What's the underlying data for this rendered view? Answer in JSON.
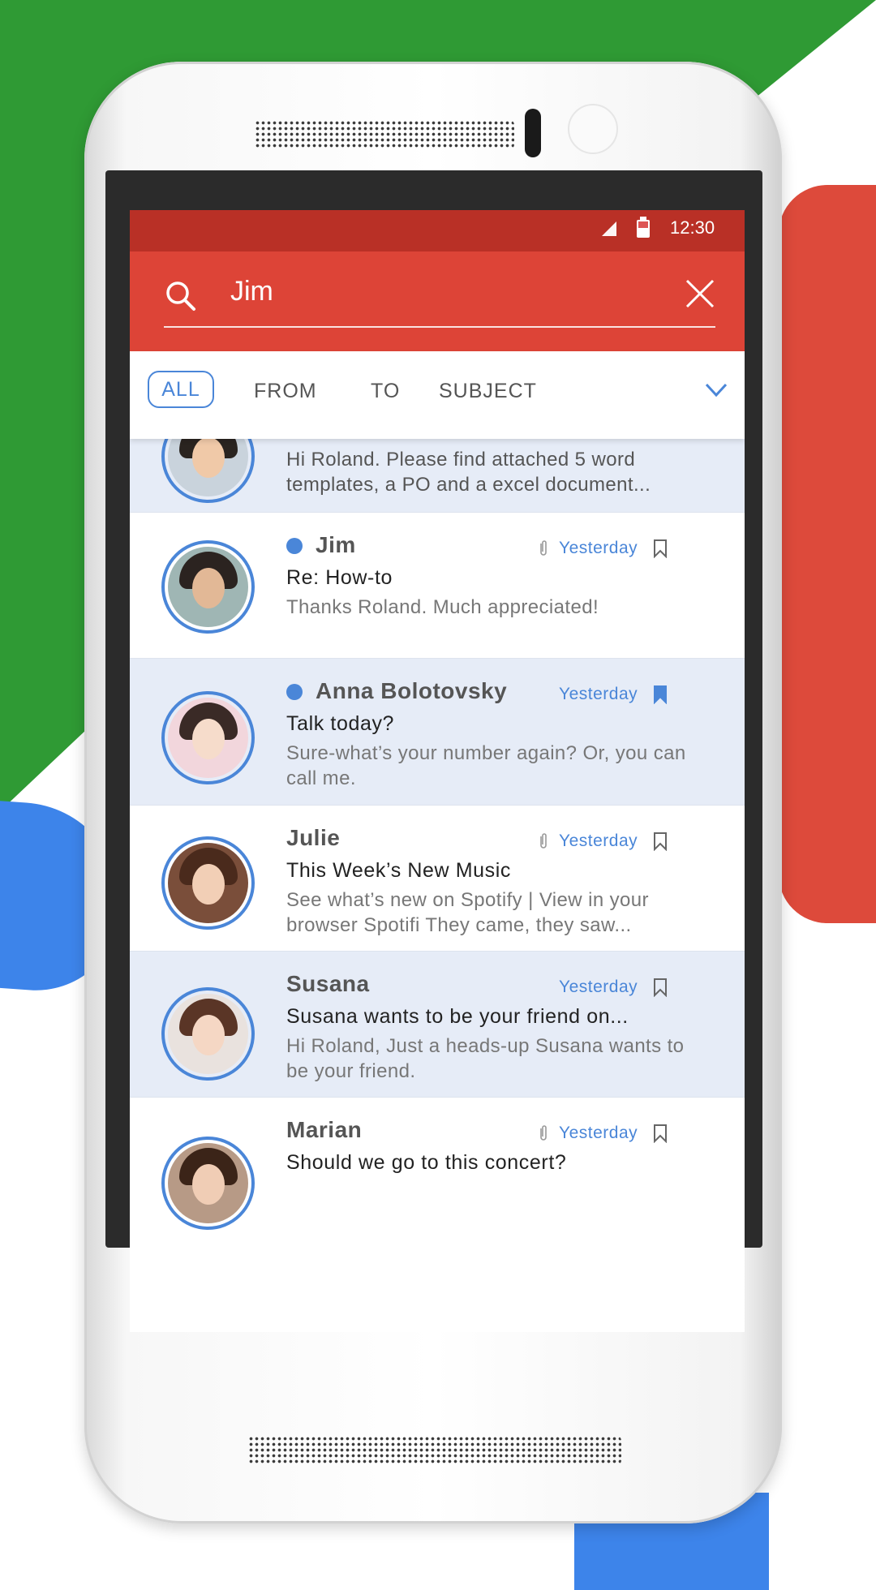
{
  "status_bar": {
    "time": "12:30"
  },
  "search": {
    "query": "Jim"
  },
  "filters": {
    "all": "ALL",
    "from": "FROM",
    "to": "TO",
    "subject": "SUBJECT"
  },
  "messages": [
    {
      "sender": "",
      "subject": "",
      "preview": "Hi Roland. Please find attached 5 word templates, a PO and a excel document...",
      "date": "",
      "unread": false,
      "attachment": false,
      "bookmarked": false
    },
    {
      "sender": "Jim",
      "subject": "Re: How-to",
      "preview": "Thanks Roland. Much appreciated!",
      "date": "Yesterday",
      "unread": true,
      "attachment": true,
      "bookmarked": false
    },
    {
      "sender": "Anna Bolotovsky",
      "subject": "Talk today?",
      "preview": "Sure-what’s your number again? Or, you can call me.",
      "date": "Yesterday",
      "unread": true,
      "attachment": false,
      "bookmarked": true
    },
    {
      "sender": "Julie",
      "subject": "This Week’s New Music",
      "preview": "See what’s new on Spotify | View in your browser Spotifi They came, they saw...",
      "date": "Yesterday",
      "unread": false,
      "attachment": true,
      "bookmarked": false
    },
    {
      "sender": "Susana",
      "subject": "Susana wants to be your friend on...",
      "preview": "Hi Roland, Just a heads-up Susana wants to be your friend.",
      "date": "Yesterday",
      "unread": false,
      "attachment": false,
      "bookmarked": false
    },
    {
      "sender": "Marian",
      "subject": "Should we go to this concert?",
      "preview": "",
      "date": "Yesterday",
      "unread": false,
      "attachment": true,
      "bookmarked": false
    }
  ],
  "colors": {
    "status_bar": "#b93026",
    "search_bar": "#dd4437",
    "accent": "#4a86d8",
    "tinted_row": "#e6ecf7"
  }
}
